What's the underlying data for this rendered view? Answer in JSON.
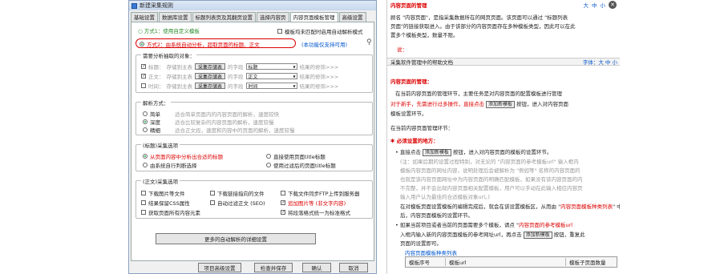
{
  "window": {
    "title": "新建采集规则"
  },
  "tabs": [
    "基础设置",
    "数据库设置",
    "标题列表页及其翻页设置",
    "选择内容页",
    "内容页面模板管理",
    "高级设置"
  ],
  "mode1": {
    "label": "○ 方式1：使用自定义模板",
    "checkbox_label": "模板均未匹配时启用自动解析模式"
  },
  "mode2": {
    "label": "方式2：由系统自动分析，超取页面的标题、正文",
    "link": "(本功能仅支持可用)"
  },
  "auto_objects": {
    "title": "需要分析抽取的对象：",
    "rows": [
      {
        "label": "标题：",
        "hint": "存储到主表",
        "field": "采集存储表",
        "col_hint": "的字段",
        "select": "标题",
        "tail": "结果的修饰>>>"
      },
      {
        "label": "正文：",
        "hint": "存储到主表",
        "field": "采集存储表",
        "col_hint": "的字段",
        "select": "正文",
        "tail": "结果的修饰>>>"
      },
      {
        "label": "时间：",
        "hint": "存储到主表",
        "field": "采集存储表",
        "col_hint": "的字段",
        "select": "时间",
        "tail": "结果的修饰>>>"
      }
    ]
  },
  "parse_mode": {
    "title": "解析方式：",
    "options": [
      {
        "label": "简单",
        "desc": "适合简单页面内的内容页面的解析，速度较快"
      },
      {
        "label": "深度",
        "desc": "适合比较复杂的内容页面的解析，速度较慢"
      },
      {
        "label": "精细",
        "desc": "适合正文段，速度和内容中的页面的解析，速度较慢"
      }
    ]
  },
  "title_opts": {
    "title": "(标题)采集选项",
    "options": [
      {
        "label": "从页面内容中分析出合适的标题",
        "red": true
      },
      {
        "label": "直接使用页面title标题"
      },
      {
        "label": "由系统自行判断选择"
      },
      {
        "label": "使用过滤后的页面title标题"
      }
    ]
  },
  "body_opts": {
    "title": "(正文)采集选项",
    "items": [
      {
        "label": "下载图片等文件",
        "on": false
      },
      {
        "label": "下载链接指向的文件",
        "on": false
      },
      {
        "label": "下载文件同步FTP上传到服务器",
        "on": false
      },
      {
        "label": "结果保留CSS属性",
        "on": false
      },
      {
        "label": "自动过滤正文 (SEO)",
        "on": false
      },
      {
        "label": "追加图片等 (非文字内容)",
        "on": true,
        "red": true
      },
      {
        "label": "获取页面所有内容元素",
        "on": false
      },
      {
        "label": "",
        "on": false
      },
      {
        "label": "将段落格式统一为标准格式",
        "on": true
      }
    ]
  },
  "more_button": "更多的自动解析的详细设置",
  "footer_buttons": [
    "项目高级设置",
    "检查并保存",
    "确认",
    "取消"
  ],
  "help": {
    "title": "内容页面的管理",
    "icons": [
      "大",
      "中",
      "小"
    ],
    "intro_1": "顾名 \"内容页面\"，是指采集数据所在的网页页面。该页面可以通过 \"标题列表",
    "intro_2": "页面\"的链接获取进入。由于该部分的内容页面存在多种模板类型，因此可以在此",
    "intro_3": "置多个模板类型，数量不限。",
    "note": "说：",
    "bar_left": "采集软件管理中的帮助文档",
    "bar_right": "字体：大 中 小",
    "section": "内容页面的管理：",
    "p1": "在当前内容页面的管理环节，主要任务是对内容页面的配置模板进行管理",
    "p2a": "对于新手，先需进行过多操作，直接点击",
    "p2btn": "添加新模板",
    "p2b": "按钮，进入对内容页面",
    "p3": "模板设置环节。",
    "p4": "在当前内容页面管理环节：",
    "must": "必须设置的地方：",
    "b1a": "直接点击",
    "b1btn": "添加新模板",
    "b1b": "按钮，进入对内容页面的模板的设置环节。",
    "b2": "(注：如果后期的设置过程特别，对无论的 \"内容页面的参考模板url\" 输入框内",
    "b3": "模板内容页面的网址内容，说明处理后会被解析为 \"例如等\" 名称的内容页面的",
    "b4": "也就是该内容页面网址中为内容页面的明确匹配模板，如果没有该内容页面的内",
    "b5": "不完整，并不会出现内容页面相关配置模板，用户可以手动在此输入相应内容页",
    "b6": "输入用户认为最佳的合适模板对象url。)",
    "b7a": "在对模板页面设置模板的编辑完成后，就会在该设置模板区，从而由 \"",
    "b7b": "内容页面模板种类列表",
    "b7c": "\" 中",
    "b8": "后，内容页面模板的设置环节。",
    "b9a": "如果当前项目或者当前的页面需要多个模板，请点 \"",
    "b9b": "内容页面的参考模板url",
    "b10a": "入框内输入新的内容页面模板的参考网址url，再点击",
    "b10btn": "添加新模板",
    "b10b": "按钮，重复此",
    "b11": "页面的设置即可。",
    "list_caption": "内容页面模板种类列表",
    "col1": "模板序号",
    "col2": "模板url",
    "col3": "模板子页面数量"
  }
}
